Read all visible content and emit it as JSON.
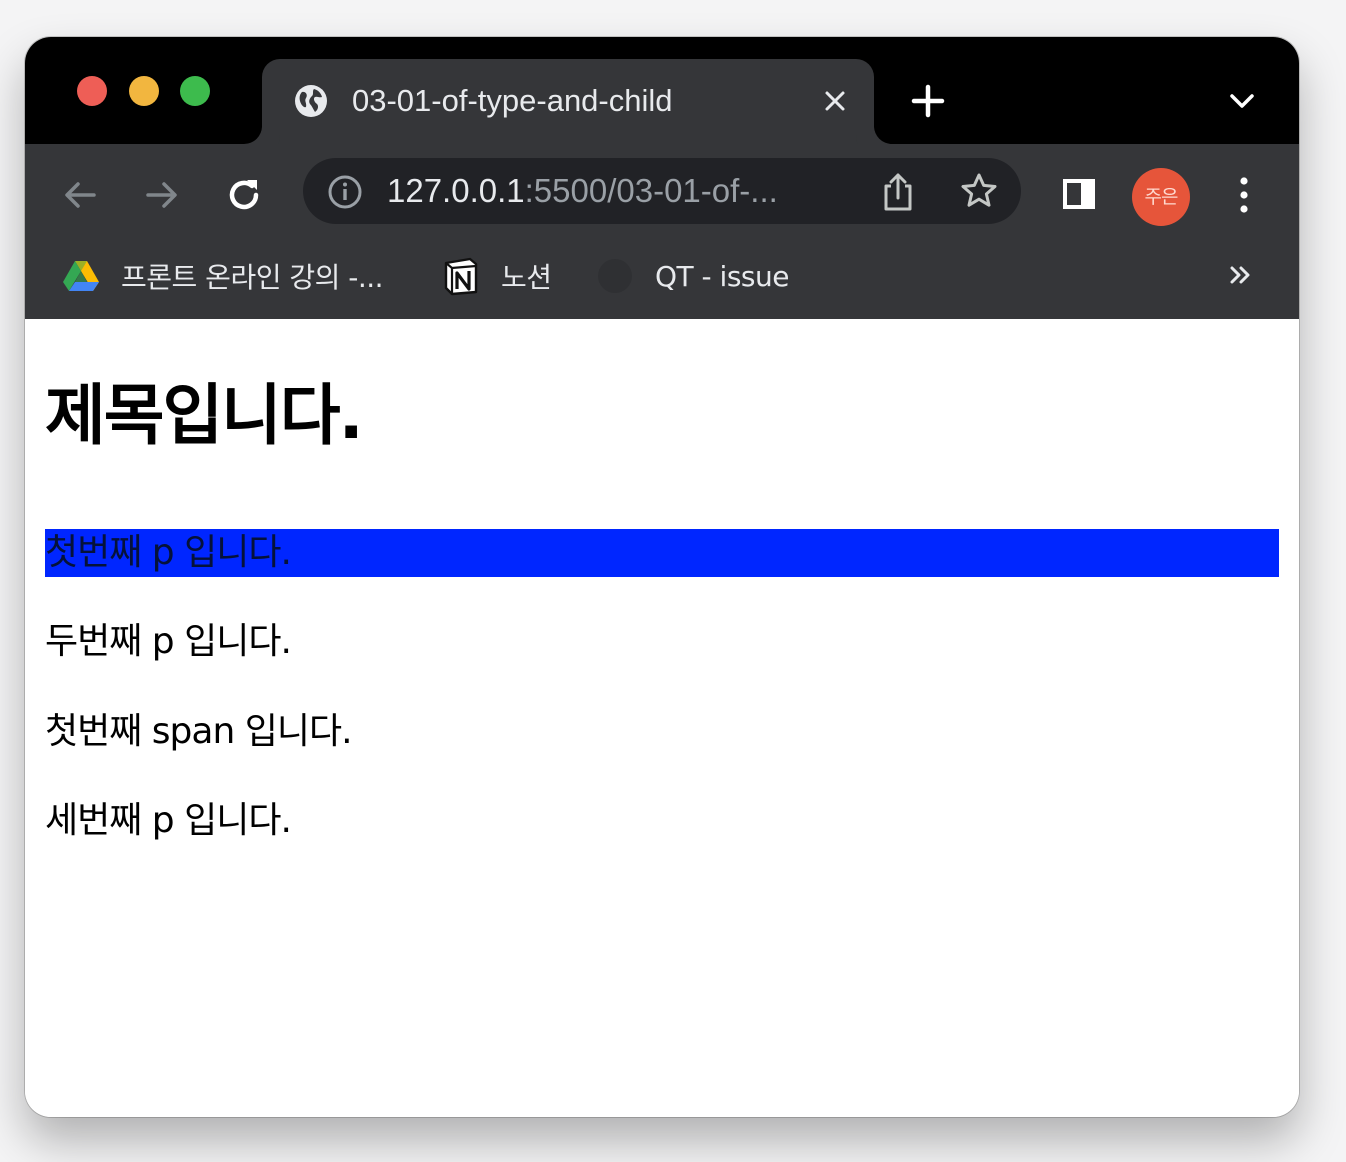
{
  "browser": {
    "tab": {
      "title": "03-01-of-type-and-child",
      "favicon": "globe-icon"
    },
    "toolbar": {
      "url_host": "127.0.0.1",
      "url_rest": ":5500/03-01-of-...",
      "profile_initials": "주은"
    },
    "bookmarks": [
      {
        "label": "프론트 온라인 강의 -...",
        "icon": "google-drive-icon"
      },
      {
        "label": "노션",
        "icon": "notion-icon"
      },
      {
        "label": "QT - issue",
        "icon": "blank-favicon-icon"
      }
    ]
  },
  "page": {
    "heading": "제목입니다.",
    "paragraphs": [
      "첫번째 p 입니다.",
      "두번째 p 입니다.",
      "첫번째 span 입니다.",
      "세번째 p 입니다."
    ]
  },
  "colors": {
    "tabstrip_bg": "#000000",
    "toolbar_bg": "#353639",
    "omnibox_bg": "#212226",
    "highlight_bg": "#0026ff",
    "avatar_bg": "#e6553a"
  }
}
